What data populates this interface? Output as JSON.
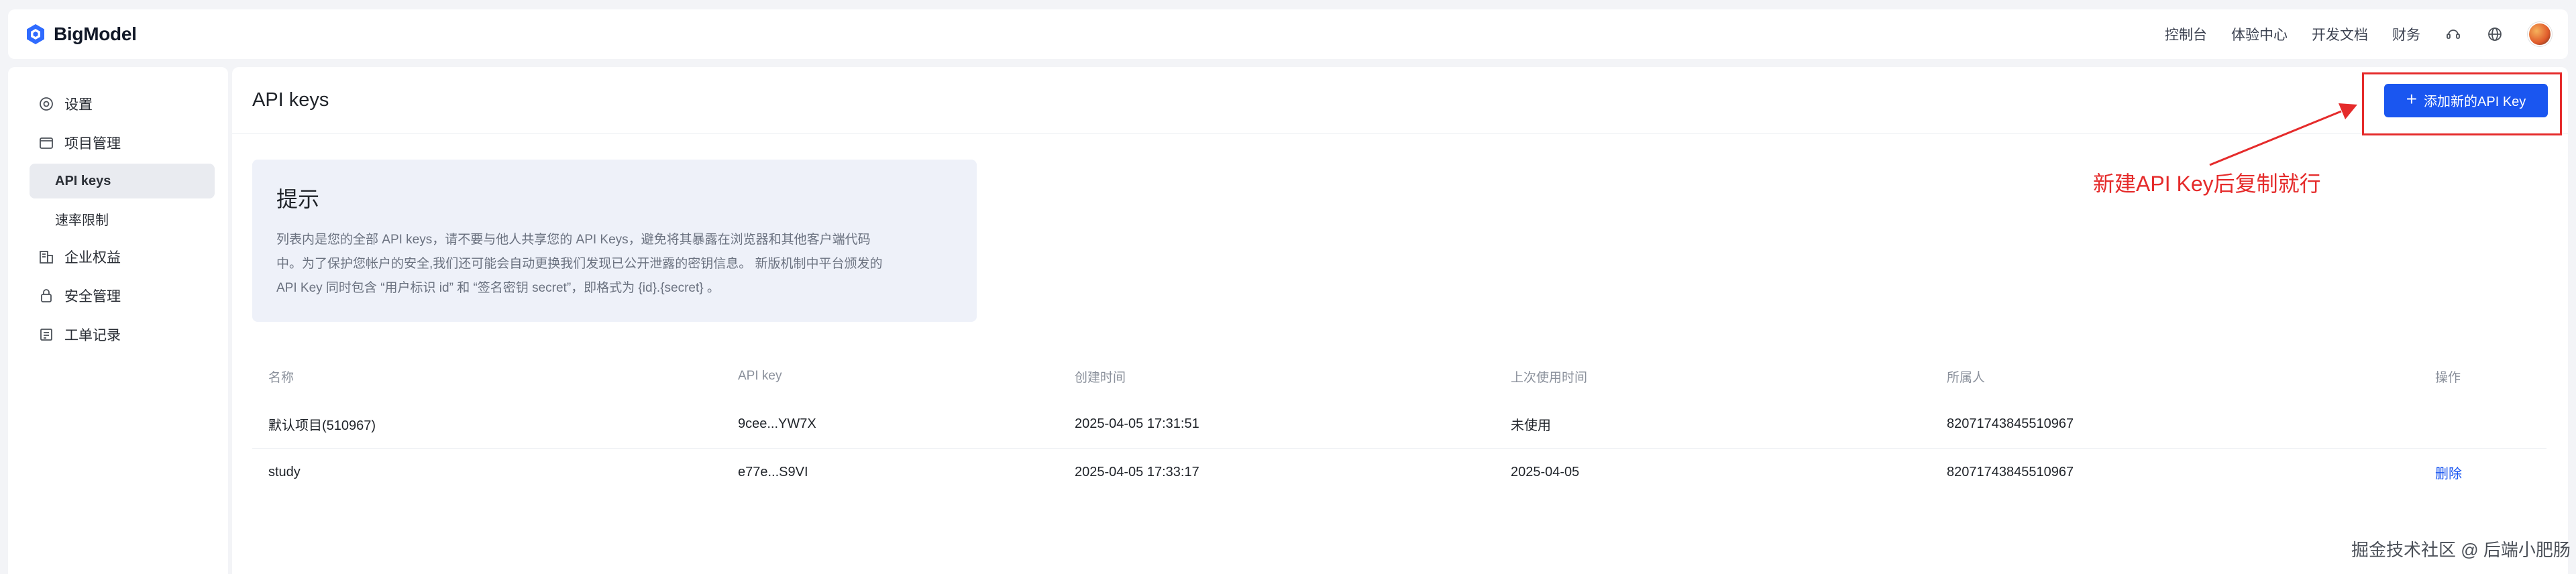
{
  "brand": {
    "name": "BigModel"
  },
  "topnav": {
    "items": [
      "控制台",
      "体验中心",
      "开发文档",
      "财务"
    ],
    "icons": [
      "support-icon",
      "globe-icon"
    ]
  },
  "sidebar": {
    "items": [
      {
        "label": "设置",
        "icon": "settings-icon"
      },
      {
        "label": "项目管理",
        "icon": "project-icon"
      }
    ],
    "sub_items": [
      {
        "label": "API keys",
        "active": true
      },
      {
        "label": "速率限制",
        "active": false
      }
    ],
    "items_after": [
      {
        "label": "企业权益",
        "icon": "enterprise-icon"
      },
      {
        "label": "安全管理",
        "icon": "lock-icon"
      },
      {
        "label": "工单记录",
        "icon": "ticket-icon"
      }
    ]
  },
  "main": {
    "title": "API keys",
    "add_button": "添加新的API Key",
    "tip": {
      "title": "提示",
      "lines": [
        "列表内是您的全部 API keys，请不要与他人共享您的 API Keys，避免将其暴露在浏览器和其他客户端代码",
        "中。为了保护您帐户的安全,我们还可能会自动更换我们发现已公开泄露的密钥信息。 新版机制中平台颁发的",
        "API Key 同时包含 “用户标识 id” 和 “签名密钥 secret”，即格式为 {id}.{secret} 。"
      ]
    },
    "table": {
      "headers": [
        "名称",
        "API key",
        "创建时间",
        "上次使用时间",
        "所属人",
        "操作"
      ],
      "rows": [
        {
          "name": "默认项目(510967)",
          "key": "9cee...YW7X",
          "created": "2025-04-05 17:31:51",
          "last_used": "未使用",
          "owner": "82071743845510967",
          "action": ""
        },
        {
          "name": "study",
          "key": "e77e...S9VI",
          "created": "2025-04-05 17:33:17",
          "last_used": "2025-04-05",
          "owner": "82071743845510967",
          "action": "删除"
        }
      ]
    }
  },
  "annotation": {
    "text": "新建API Key后复制就行",
    "color": "#e52b2b"
  },
  "watermark": "掘金技术社区 @ 后端小肥肠",
  "colors": {
    "primary": "#1a56f0",
    "annotation": "#e52b2b"
  }
}
